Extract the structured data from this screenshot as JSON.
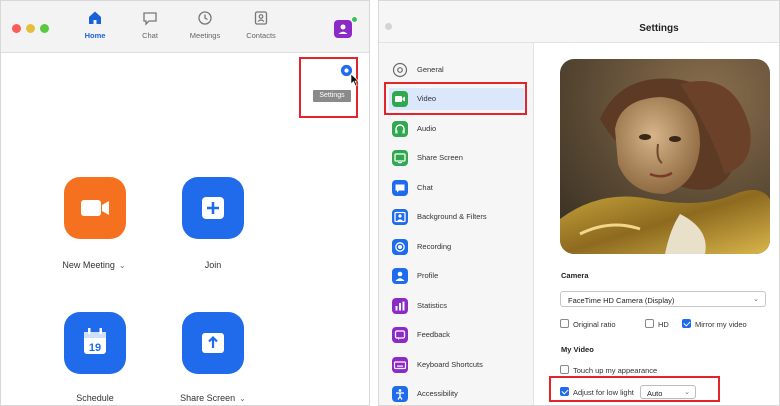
{
  "home": {
    "nav": [
      {
        "id": "home",
        "label": "Home",
        "icon": "home-icon"
      },
      {
        "id": "chat",
        "label": "Chat",
        "icon": "chat-icon"
      },
      {
        "id": "meetings",
        "label": "Meetings",
        "icon": "clock-icon"
      },
      {
        "id": "contacts",
        "label": "Contacts",
        "icon": "contacts-icon"
      }
    ],
    "settings_tooltip": "Settings",
    "actions": [
      {
        "label": "New Meeting",
        "color": "#f5701f",
        "icon": "video-camera-icon",
        "has_dropdown": true
      },
      {
        "label": "Join",
        "color": "#1f6bec",
        "icon": "plus-icon",
        "has_dropdown": false
      },
      {
        "label": "Schedule",
        "color": "#1f6bec",
        "icon": "calendar-icon",
        "calendar_day": "19",
        "has_dropdown": false
      },
      {
        "label": "Share Screen",
        "color": "#1f6bec",
        "icon": "share-screen-icon",
        "has_dropdown": true
      }
    ]
  },
  "settings": {
    "title": "Settings",
    "sidebar": [
      {
        "label": "General",
        "icon": "gear-icon",
        "color": "#6b6b6b"
      },
      {
        "label": "Video",
        "icon": "video-icon",
        "color": "#2fa84f",
        "selected": true
      },
      {
        "label": "Audio",
        "icon": "headphones-icon",
        "color": "#2fa84f"
      },
      {
        "label": "Share Screen",
        "icon": "share-screen-icon",
        "color": "#2fa84f"
      },
      {
        "label": "Chat",
        "icon": "chat-icon",
        "color": "#1f6bec"
      },
      {
        "label": "Background & Filters",
        "icon": "background-icon",
        "color": "#1f6bec"
      },
      {
        "label": "Recording",
        "icon": "recording-icon",
        "color": "#1f6bec"
      },
      {
        "label": "Profile",
        "icon": "profile-icon",
        "color": "#1f6bec"
      },
      {
        "label": "Statistics",
        "icon": "statistics-icon",
        "color": "#8b2ac7"
      },
      {
        "label": "Feedback",
        "icon": "feedback-icon",
        "color": "#8b2ac7"
      },
      {
        "label": "Keyboard Shortcuts",
        "icon": "keyboard-icon",
        "color": "#8b2ac7"
      },
      {
        "label": "Accessibility",
        "icon": "accessibility-icon",
        "color": "#1f6bec"
      }
    ],
    "camera_heading": "Camera",
    "camera_value": "FaceTime HD Camera (Display)",
    "camera_options_row": [
      {
        "label": "Original ratio",
        "checked": false
      },
      {
        "label": "HD",
        "checked": false
      },
      {
        "label": "Mirror my video",
        "checked": true
      }
    ],
    "my_video_heading": "My Video",
    "touch_up": {
      "label": "Touch up my appearance",
      "checked": false
    },
    "low_light": {
      "label": "Adjust for low light",
      "checked": true,
      "value": "Auto"
    }
  },
  "colors": {
    "accent_blue": "#1f6bec",
    "orange": "#f5701f",
    "highlight_red": "#e4242c",
    "selected_bg": "#dbe8fb"
  }
}
